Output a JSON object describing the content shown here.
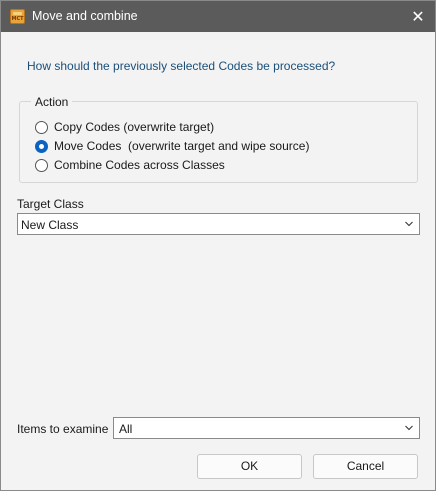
{
  "window": {
    "title": "Move and combine",
    "app_icon_text": "MCT",
    "close_symbol": "✕"
  },
  "question": "How should the previously selected Codes be processed?",
  "action_group": {
    "legend": "Action",
    "options": [
      {
        "label": "Copy Codes (overwrite target)",
        "selected": false
      },
      {
        "label": "Move Codes  (overwrite target and wipe source)",
        "selected": true
      },
      {
        "label": "Combine Codes across Classes",
        "selected": false
      }
    ]
  },
  "target_class": {
    "label": "Target Class",
    "value": "New Class"
  },
  "items_to_examine": {
    "label": "Items to examine",
    "value": "All"
  },
  "buttons": {
    "ok": "OK",
    "cancel": "Cancel"
  },
  "colors": {
    "titlebar": "#5b5b5b",
    "question_text": "#1b4f7a",
    "radio_accent": "#0a62c2"
  }
}
